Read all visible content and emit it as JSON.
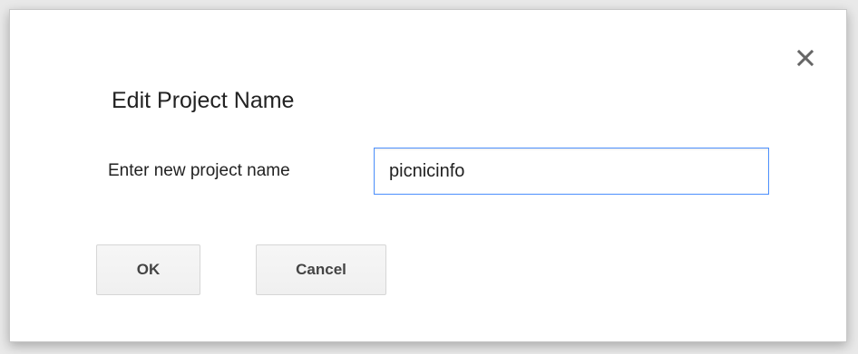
{
  "dialog": {
    "title": "Edit Project Name",
    "close_icon": "close-icon",
    "field_label": "Enter new project name",
    "field_value": "picnicinfo",
    "ok_label": "OK",
    "cancel_label": "Cancel"
  },
  "colors": {
    "input_focus_border": "#4d90fe",
    "button_background": "#f1f1f1",
    "button_text": "#444444",
    "text": "#222222"
  }
}
